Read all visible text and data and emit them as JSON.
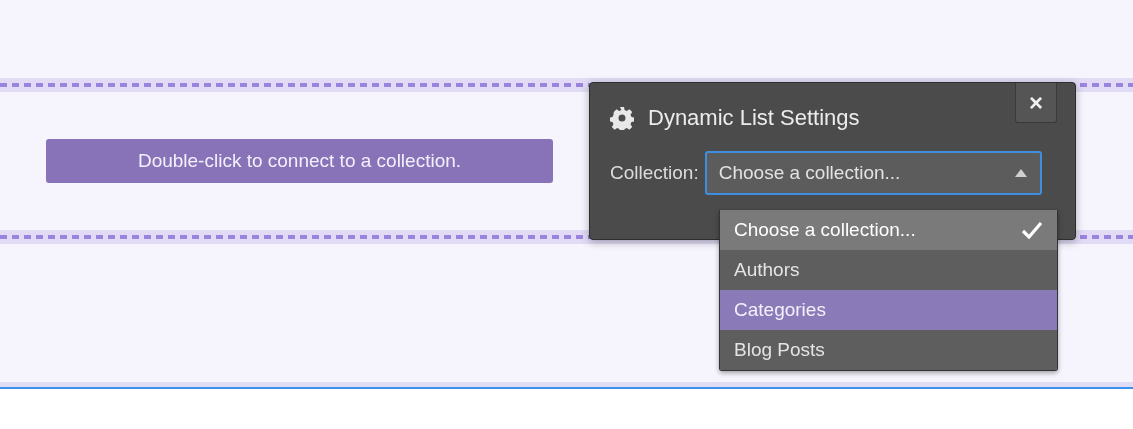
{
  "list_placeholder": {
    "text": "Double-click to connect to a collection."
  },
  "dialog": {
    "title": "Dynamic List Settings",
    "close": "×",
    "field_label": "Collection:",
    "select_value": "Choose a collection...",
    "expanded": true,
    "options": [
      {
        "label": "Choose a collection...",
        "selected": true,
        "highlighted": false
      },
      {
        "label": "Authors",
        "selected": false,
        "highlighted": false
      },
      {
        "label": "Categories",
        "selected": false,
        "highlighted": true
      },
      {
        "label": "Blog Posts",
        "selected": false,
        "highlighted": false
      }
    ]
  }
}
